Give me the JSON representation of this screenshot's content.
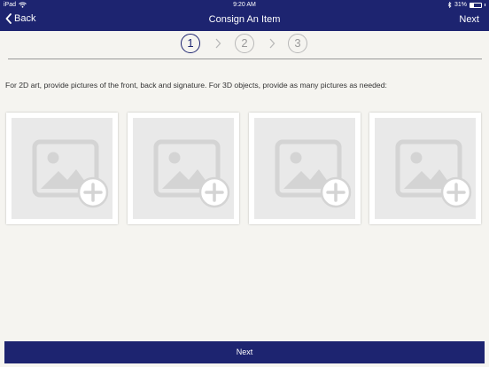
{
  "status_bar": {
    "device": "iPad",
    "time": "9:20 AM",
    "battery": "31%",
    "battery_level": 0.31
  },
  "nav": {
    "back_label": "Back",
    "title": "Consign An Item",
    "next_label": "Next"
  },
  "stepper": {
    "steps": [
      "1",
      "2",
      "3"
    ],
    "active_step": 1
  },
  "instructions": "For 2D art, provide pictures of the front, back and signature.  For 3D objects, provide as many pictures as needed:",
  "photo_slots": 4,
  "footer": {
    "next_label": "Next"
  },
  "colors": {
    "brand": "#1d2470",
    "background": "#f5f4f0",
    "placeholder": "#e9e9e9"
  }
}
